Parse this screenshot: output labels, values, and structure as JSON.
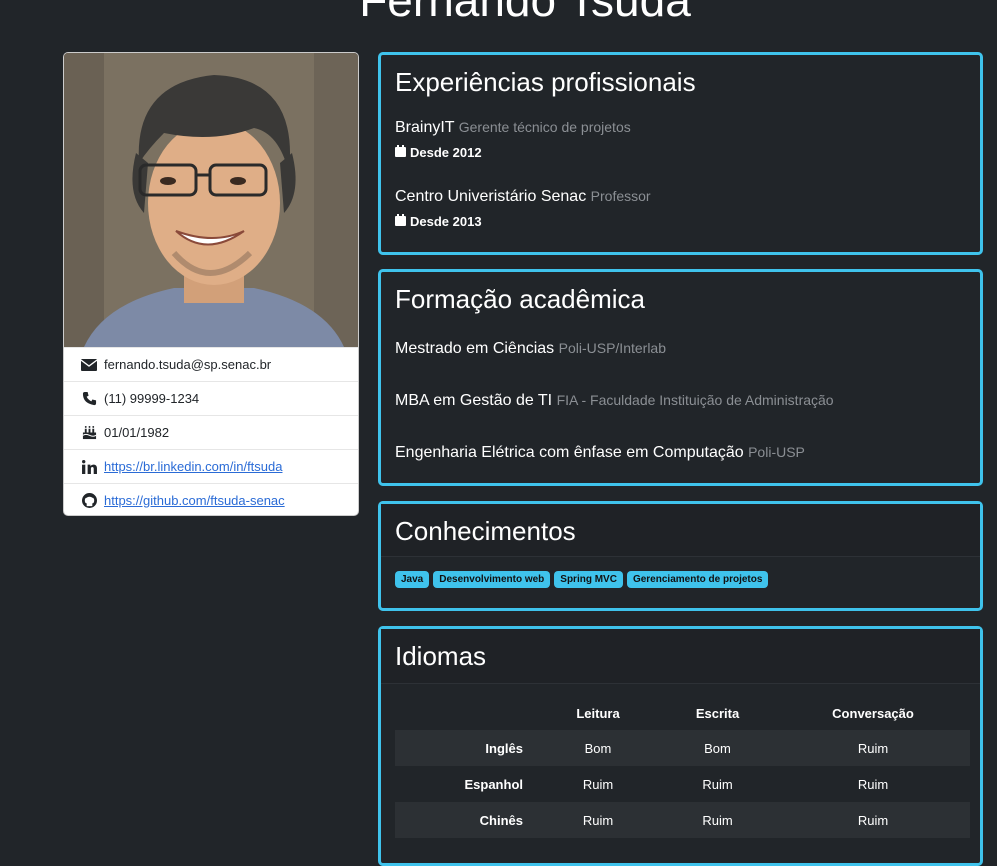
{
  "page": {
    "title": "Fernando Tsuda"
  },
  "profile": {
    "email": "fernando.tsuda@sp.senac.br",
    "phone": "(11) 99999-1234",
    "birthday": "01/01/1982",
    "linkedin": "https://br.linkedin.com/in/ftsuda",
    "github": "https://github.com/ftsuda-senac"
  },
  "experience": {
    "title": "Experiências profissionais",
    "items": [
      {
        "company": "BrainyIT",
        "role": "Gerente técnico de projetos",
        "since": "Desde 2012"
      },
      {
        "company": "Centro Univeristário Senac",
        "role": "Professor",
        "since": "Desde 2013"
      }
    ]
  },
  "education": {
    "title": "Formação acadêmica",
    "items": [
      {
        "course": "Mestrado em Ciências",
        "school": "Poli-USP/Interlab"
      },
      {
        "course": "MBA em Gestão de TI",
        "school": "FIA - Faculdade Instituição de Administração"
      },
      {
        "course": "Engenharia Elétrica com ênfase em Computação",
        "school": "Poli-USP"
      }
    ]
  },
  "skills": {
    "title": "Conhecimentos",
    "badges": [
      "Java",
      "Desenvolvimento web",
      "Spring MVC",
      "Gerenciamento de projetos"
    ]
  },
  "languages": {
    "title": "Idiomas",
    "headers": [
      "Leitura",
      "Escrita",
      "Conversação"
    ],
    "rows": [
      {
        "lang": "Inglês",
        "values": [
          "Bom",
          "Bom",
          "Ruim"
        ]
      },
      {
        "lang": "Espanhol",
        "values": [
          "Ruim",
          "Ruim",
          "Ruim"
        ]
      },
      {
        "lang": "Chinês",
        "values": [
          "Ruim",
          "Ruim",
          "Ruim"
        ]
      }
    ]
  },
  "colors": {
    "accent": "#3fc3ec",
    "background": "#212529"
  }
}
